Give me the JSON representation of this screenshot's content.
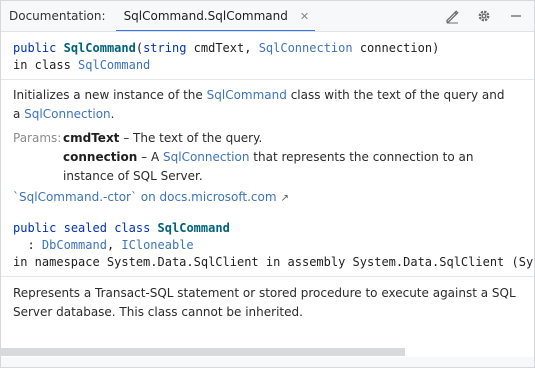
{
  "header": {
    "prefix": "Documentation:",
    "tab_label": "SqlCommand.SqlCommand",
    "close_glyph": "✕",
    "icons": [
      "edit-icon",
      "gear-icon",
      "minimize-icon"
    ]
  },
  "signature": {
    "kw_public": "public",
    "name": "SqlCommand",
    "open_paren": "(",
    "kw_string": "string",
    "param1": " cmdText, ",
    "type_conn": "SqlConnection",
    "param2": " connection)",
    "in_class": "in class ",
    "class_name": "SqlCommand"
  },
  "summary": {
    "part1": "Initializes a new instance of the ",
    "link1": "SqlCommand",
    "part2": " class with the text of the query and a ",
    "link2": "SqlConnection",
    "part3": "."
  },
  "params": {
    "label": "Params:",
    "p1_name": "cmdText",
    "p1_text": " – The text of the query.",
    "p2_name": "connection",
    "p2_pre": " – A ",
    "p2_link": "SqlConnection",
    "p2_text": " that represents the connection to an instance of SQL Server."
  },
  "external_link": {
    "text": "`SqlCommand.-ctor` on docs.microsoft.com",
    "arrow": "↗"
  },
  "declaration": {
    "kw_public": "public",
    "kw_sealed": "sealed",
    "kw_class": "class",
    "name": "SqlCommand",
    "colon": "  : ",
    "base1": "DbCommand",
    "comma": ", ",
    "base2": "ICloneable",
    "namespace_line": "in namespace System.Data.SqlClient in assembly System.Data.SqlClient (Syste"
  },
  "class_summary": "Represents a Transact-SQL statement or stored procedure to execute against a SQL Server database. This class cannot be inherited.",
  "colors": {
    "accent": "#3574f0",
    "link": "#3d74b9",
    "keyword": "#0033b3",
    "type": "#1b7aa6"
  }
}
